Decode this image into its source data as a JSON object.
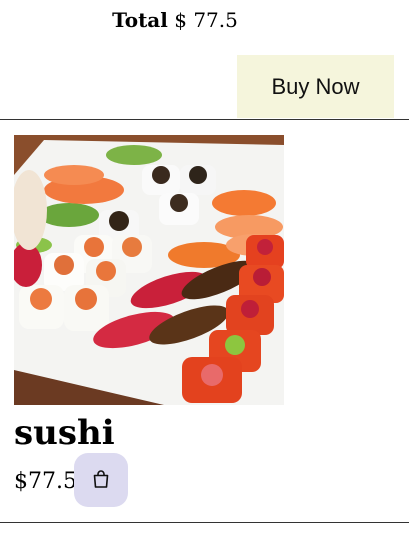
{
  "cart": {
    "total_label": "Total",
    "total_value": "$ 77.5",
    "buy_label": "Buy Now"
  },
  "product": {
    "name": "sushi",
    "price": "$77.5",
    "image_alt": "sushi platter",
    "cart_icon": "shopping-bag-icon"
  },
  "colors": {
    "buy_button_bg": "#f5f5dc",
    "cart_button_bg": "#dcdaf0"
  }
}
